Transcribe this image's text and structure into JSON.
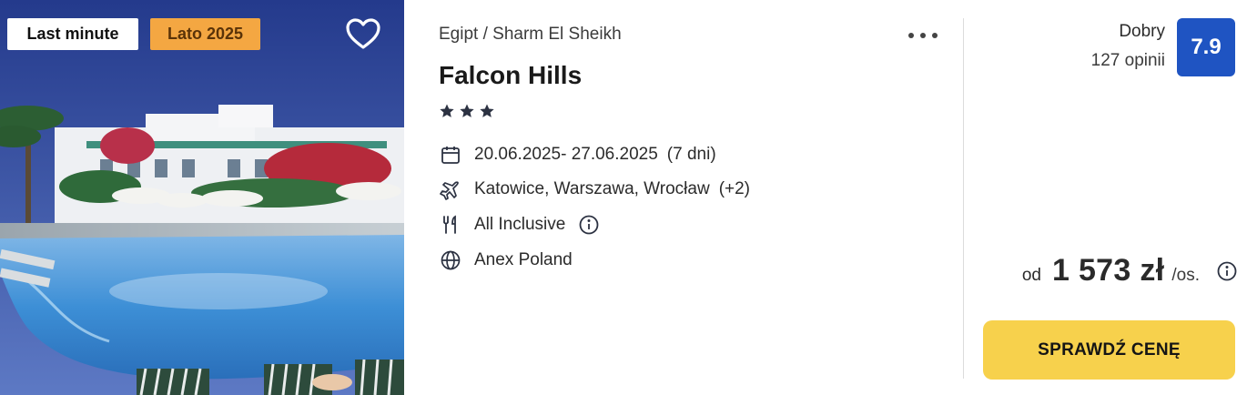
{
  "photo": {
    "badges": {
      "last_minute": "Last minute",
      "season": "Lato 2025"
    },
    "favorite_icon": "heart-outline-icon",
    "colors": {
      "season_badge": "#f4a742",
      "sky": "#2e4899",
      "pool": "#3d8fd6"
    }
  },
  "offer": {
    "location": "Egipt / Sharm El Sheikh",
    "more_icon": "more-horizontal-icon",
    "hotel_name": "Falcon Hills",
    "stars": 3,
    "dates": "20.06.2025- 27.06.2025",
    "duration": "(7 dni)",
    "departures": "Katowice, Warszawa, Wrocław",
    "departures_extra": "(+2)",
    "board": "All Inclusive",
    "operator": "Anex Poland",
    "icons": {
      "dates": "calendar-icon",
      "departures": "plane-icon",
      "board": "cutlery-icon",
      "operator": "globe-icon",
      "info": "info-icon"
    }
  },
  "rating": {
    "label": "Dobry",
    "count": "127 opinii",
    "score": "7.9",
    "color": "#1f54c2"
  },
  "price": {
    "from": "od",
    "value": "1 573 zł",
    "unit": "/os."
  },
  "cta": {
    "label": "SPRAWDŹ CENĘ",
    "color": "#f7d14c"
  }
}
